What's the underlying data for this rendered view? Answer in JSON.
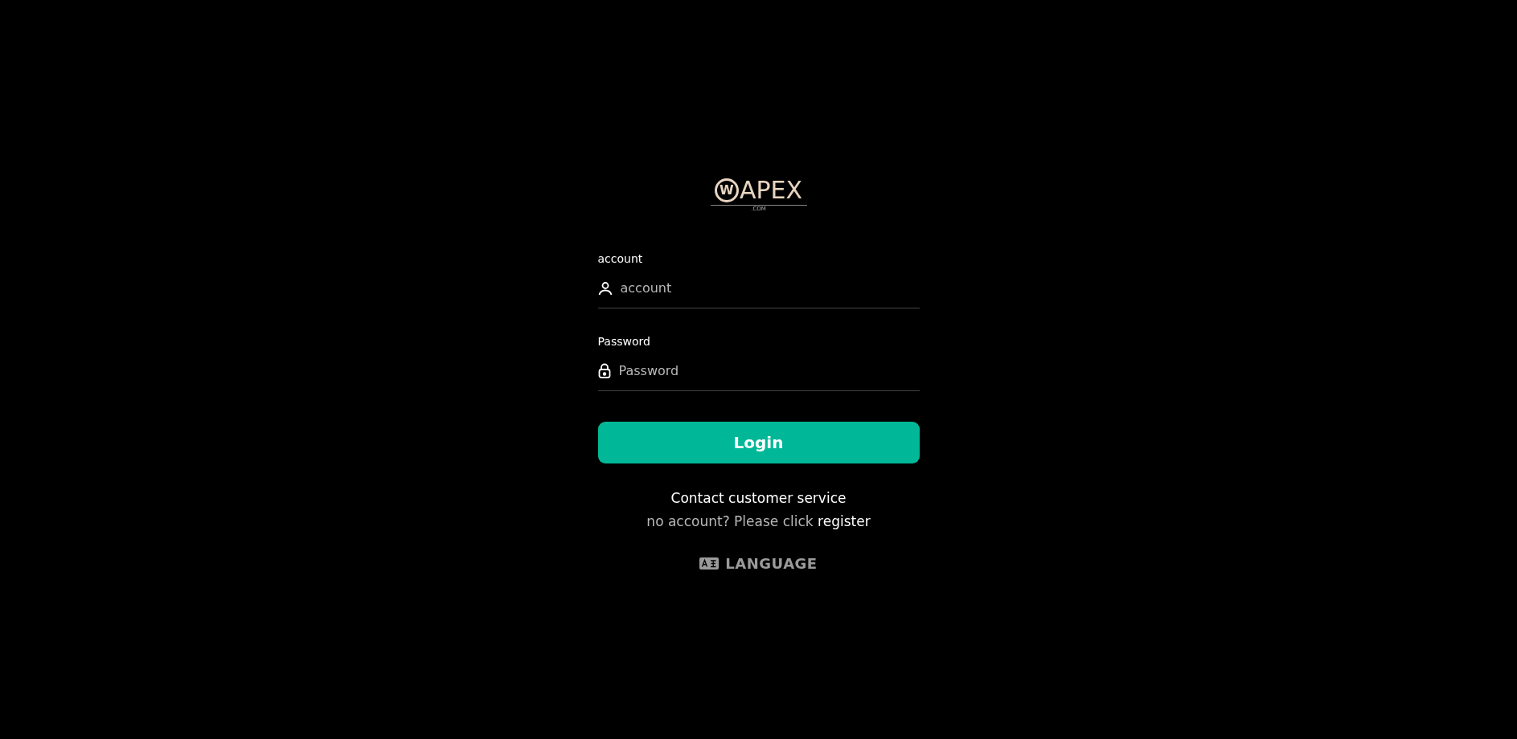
{
  "logo": {
    "mark": "W",
    "name": "APEX",
    "suffix": ".COM"
  },
  "fields": [
    {
      "label": "account",
      "placeholder": "account",
      "kind": "user"
    },
    {
      "label": "Password",
      "placeholder": "Password",
      "kind": "lock"
    }
  ],
  "login_button": "Login",
  "contact_link": "Contact customer service",
  "register_prompt": {
    "text": "no account? Please click",
    "link": "register"
  },
  "language_button": "LANGUAGE"
}
